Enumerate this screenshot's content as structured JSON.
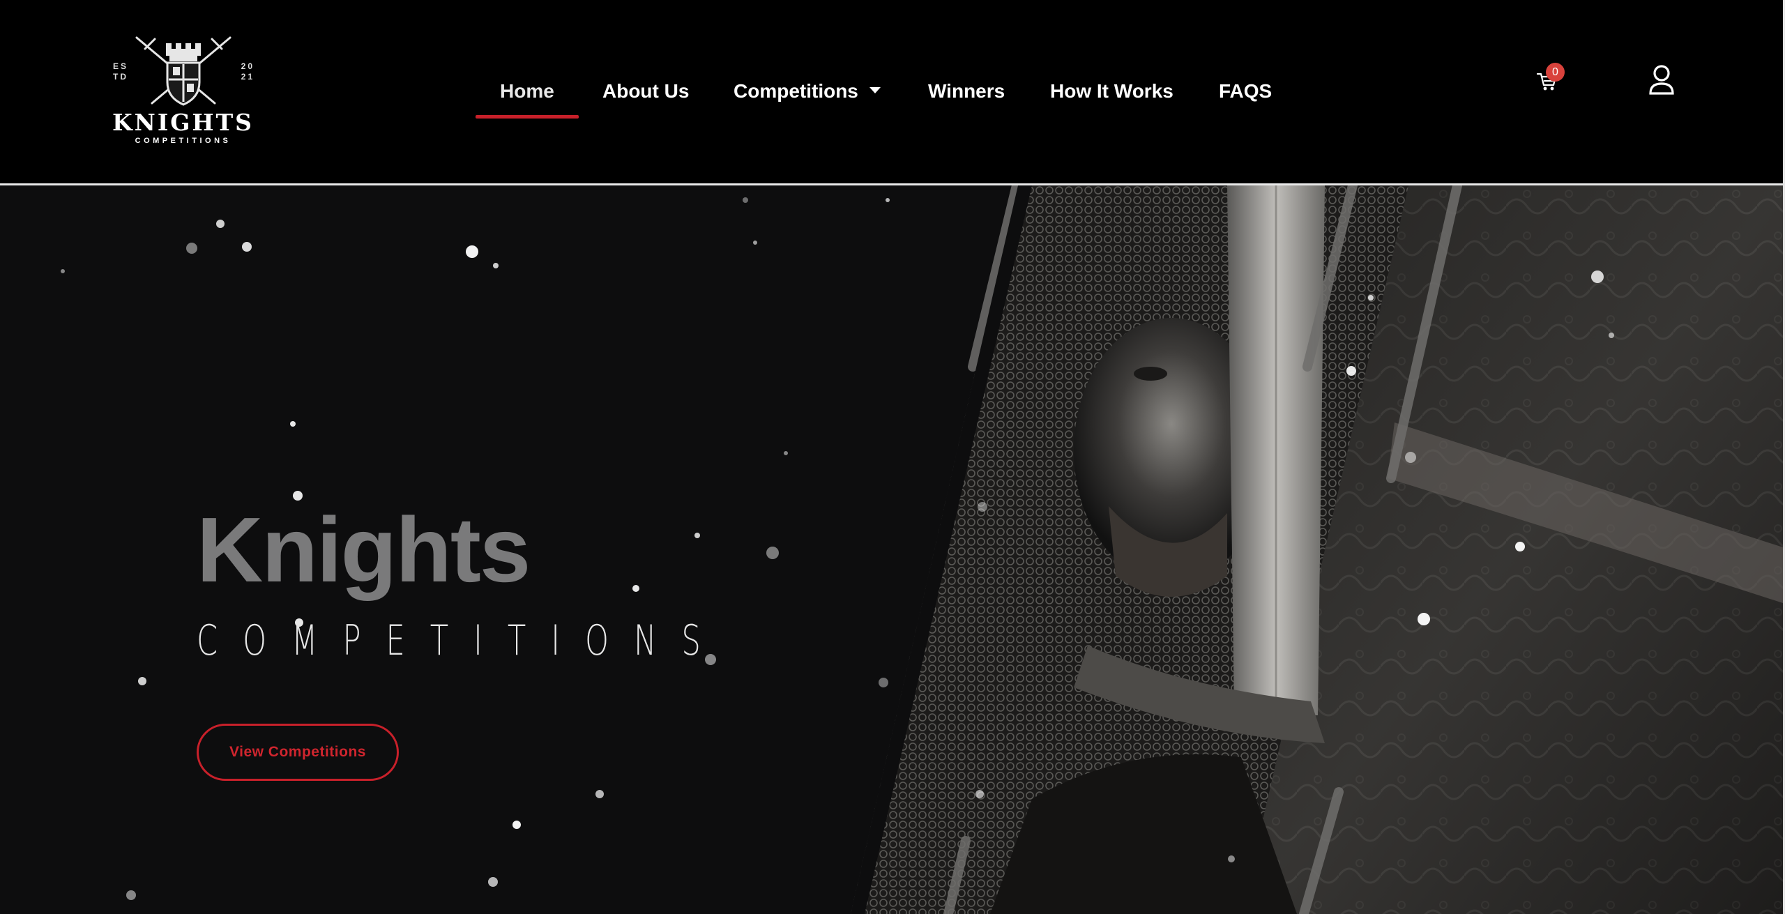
{
  "logo": {
    "estd": "ES TD",
    "year": "20 21",
    "brand": "KNIGHTS",
    "brand_sub": "COMPETITIONS"
  },
  "nav": {
    "items": [
      {
        "label": "Home",
        "active": true
      },
      {
        "label": "About Us"
      },
      {
        "label": "Competitions",
        "has_dropdown": true
      },
      {
        "label": "Winners"
      },
      {
        "label": "How It Works"
      },
      {
        "label": "FAQS"
      }
    ]
  },
  "cart": {
    "count": "0",
    "icon": "cart-icon"
  },
  "user": {
    "icon": "user-icon"
  },
  "hero": {
    "title": "Knights",
    "subtitle": "COMPETITIONS",
    "cta_label": "View Competitions"
  },
  "colors": {
    "accent": "#c8202a",
    "badge": "#d9423c",
    "background": "#000000",
    "hero_bg": "#0d0d0e",
    "title_gray": "#7a7a7b"
  }
}
